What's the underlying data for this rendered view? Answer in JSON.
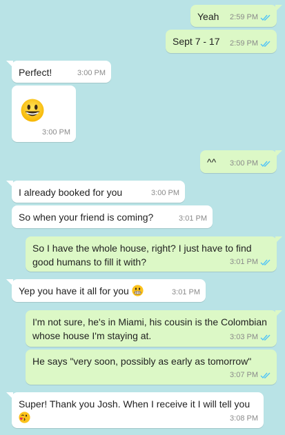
{
  "colors": {
    "background": "#b9e3e6",
    "incoming_bubble": "#ffffff",
    "outgoing_bubble": "#dcf8c6",
    "read_ticks": "#4fc3f7",
    "timestamp": "#8a8a8a"
  },
  "messages": [
    {
      "dir": "out",
      "text": "Yeah",
      "time": "2:59 PM",
      "status": "read"
    },
    {
      "dir": "out",
      "text": "Sept 7 - 17",
      "time": "2:59 PM",
      "status": "read"
    },
    {
      "dir": "in",
      "text": "Perfect!",
      "time": "3:00 PM"
    },
    {
      "dir": "in",
      "emoji": "grinning-face-emoji",
      "time": "3:00 PM"
    },
    {
      "dir": "out",
      "text": "^^",
      "time": "3:00 PM",
      "status": "read"
    },
    {
      "dir": "in",
      "text": "I already booked for you",
      "time": "3:00 PM"
    },
    {
      "dir": "in",
      "text": "So when your friend is coming?",
      "time": "3:01 PM"
    },
    {
      "dir": "out",
      "text": "So I have the whole house, right? I just have to find good humans to fill it with?",
      "time": "3:01 PM",
      "status": "read"
    },
    {
      "dir": "in",
      "text": "Yep you have it all for you",
      "emoji": "grimacing-face-emoji",
      "time": "3:01 PM"
    },
    {
      "dir": "out",
      "text": "I'm not sure, he's in Miami, his cousin is the Colombian whose house I'm staying at.",
      "time": "3:03 PM",
      "status": "read"
    },
    {
      "dir": "out",
      "text": "He says \"very soon, possibly as early as tomorrow\"",
      "time": "3:07 PM",
      "status": "read"
    },
    {
      "dir": "in",
      "text": "Super! Thank you Josh. When I receive it I will tell you",
      "emoji": "face-blowing-kiss-emoji",
      "time": "3:08 PM"
    }
  ]
}
